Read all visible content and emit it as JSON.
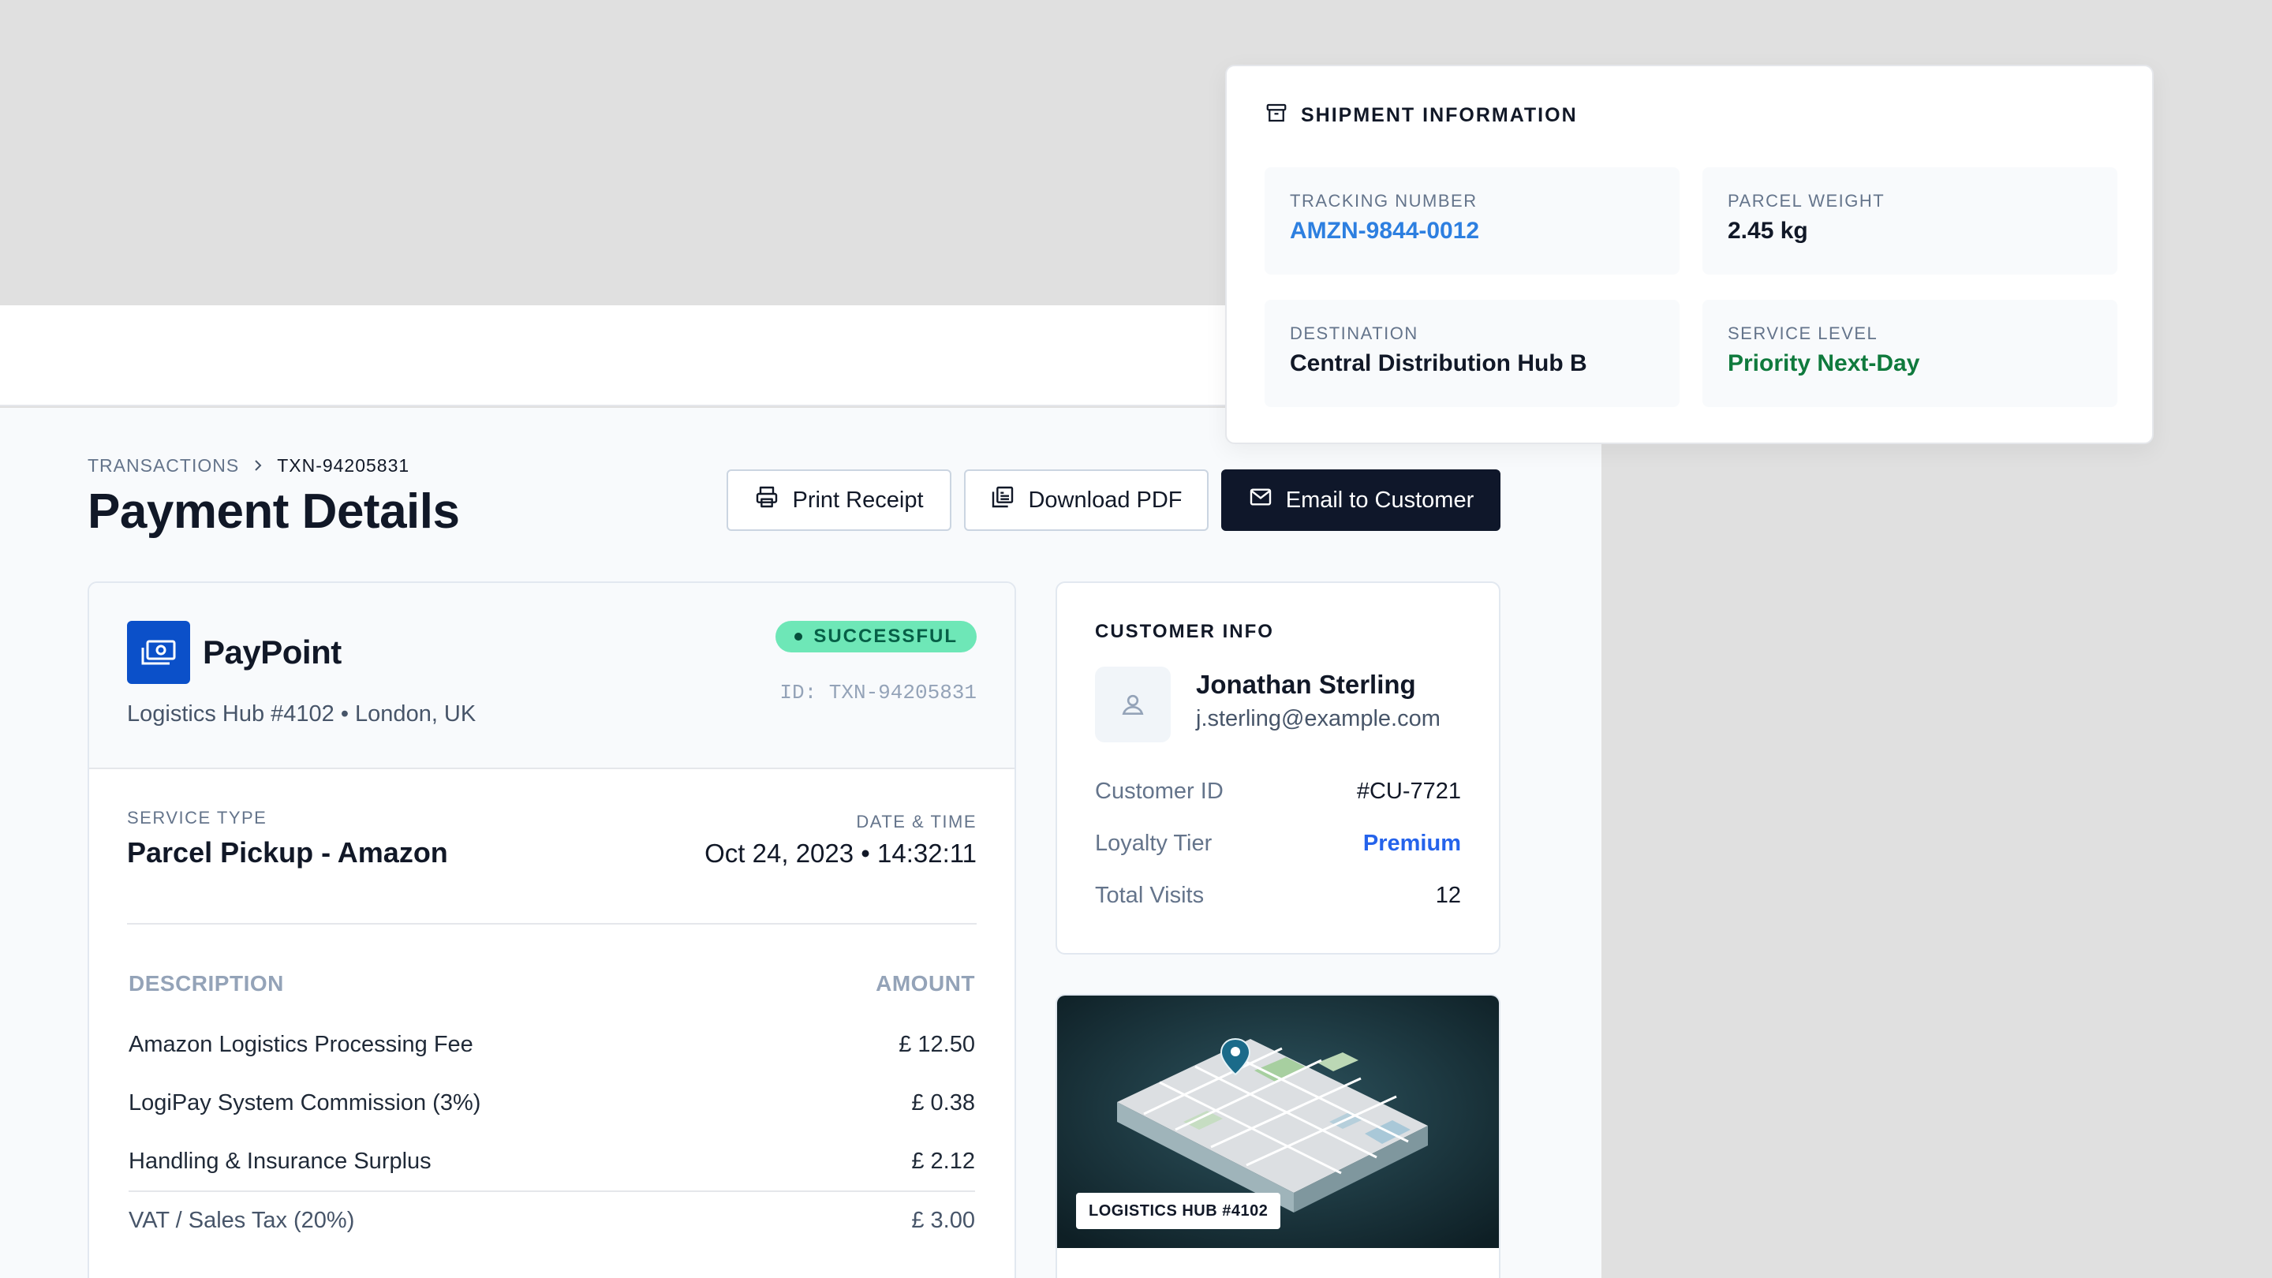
{
  "breadcrumb": {
    "section": "TRANSACTIONS",
    "current": "TXN-94205831"
  },
  "page_title": "Payment Details",
  "actions": {
    "print": "Print Receipt",
    "download": "Download PDF",
    "email": "Email to Customer"
  },
  "merchant": {
    "name": "PayPoint",
    "location": "Logistics Hub #4102 • London, UK",
    "status": "SUCCESSFUL",
    "transaction_id": "ID: TXN-94205831"
  },
  "service": {
    "type_label": "SERVICE TYPE",
    "type_value": "Parcel Pickup - Amazon",
    "date_label": "DATE & TIME",
    "date_value": "Oct 24, 2023 • 14:32:11"
  },
  "line_items": {
    "description_header": "DESCRIPTION",
    "amount_header": "AMOUNT",
    "items": [
      {
        "description": "Amazon Logistics Processing Fee",
        "amount": "£ 12.50"
      },
      {
        "description": "LogiPay System Commission (3%)",
        "amount": "£ 0.38"
      },
      {
        "description": "Handling & Insurance Surplus",
        "amount": "£ 2.12"
      },
      {
        "description": "VAT / Sales Tax (20%)",
        "amount": "£ 3.00"
      }
    ]
  },
  "customer": {
    "title": "CUSTOMER INFO",
    "name": "Jonathan Sterling",
    "email": "j.sterling@example.com",
    "fields": [
      {
        "label": "Customer ID",
        "value": "#CU-7721"
      },
      {
        "label": "Loyalty Tier",
        "value": "Premium"
      },
      {
        "label": "Total Visits",
        "value": "12"
      }
    ]
  },
  "map": {
    "label": "LOGISTICS HUB #4102"
  },
  "shipment": {
    "title": "SHIPMENT INFORMATION",
    "tracking_label": "TRACKING NUMBER",
    "tracking_value": "AMZN-9844-0012",
    "weight_label": "PARCEL WEIGHT",
    "weight_value": "2.45 kg",
    "destination_label": "DESTINATION",
    "destination_value": "Central Distribution Hub B",
    "service_label": "SERVICE LEVEL",
    "service_value": "Priority Next-Day"
  },
  "colors": {
    "brand": "#0b50c9",
    "success_badge": "#6ee7b7",
    "link_blue": "#2d7fe0",
    "priority_green": "#0f7a3d",
    "dark_button": "#0f172a"
  },
  "icons": [
    "printer-icon",
    "pdf-icon",
    "mail-icon",
    "money-icon",
    "user-icon",
    "map-pin-icon",
    "archive-icon",
    "chevron-right-icon"
  ]
}
